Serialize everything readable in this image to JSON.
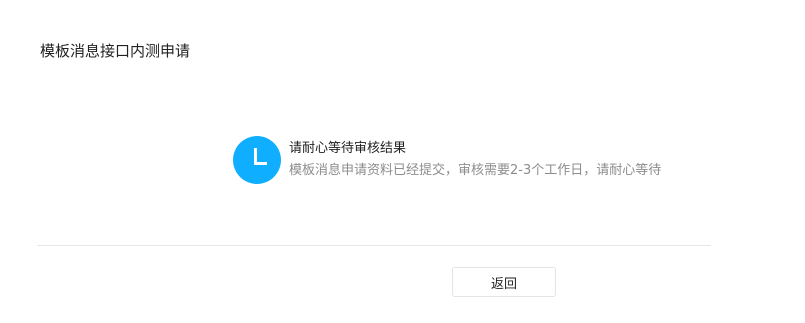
{
  "page": {
    "title": "模板消息接口内测申请"
  },
  "status": {
    "icon": "waiting-clock-icon",
    "icon_color": "#10aeff",
    "title": "请耐心等待审核结果",
    "description": "模板消息申请资料已经提交，审核需要2-3个工作日，请耐心等待"
  },
  "actions": {
    "back_label": "返回"
  }
}
